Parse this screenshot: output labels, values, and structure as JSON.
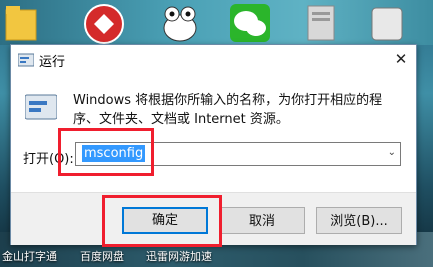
{
  "dialog": {
    "title": "运行",
    "description": "Windows 将根据你所输入的名称，为你打开相应的程序、文件夹、文档或 Internet 资源。",
    "open_label": "打开(O):",
    "input_value": "msconfig",
    "buttons": {
      "ok": "确定",
      "cancel": "取消",
      "browse": "浏览(B)..."
    },
    "close_glyph": "✕"
  },
  "taskbar_labels": [
    "金山打字通",
    "百度网盘",
    "迅雷网游加速"
  ],
  "colors": {
    "selection": "#3399ff",
    "highlight_box": "#f01e2e",
    "primary_border": "#0078d7"
  }
}
